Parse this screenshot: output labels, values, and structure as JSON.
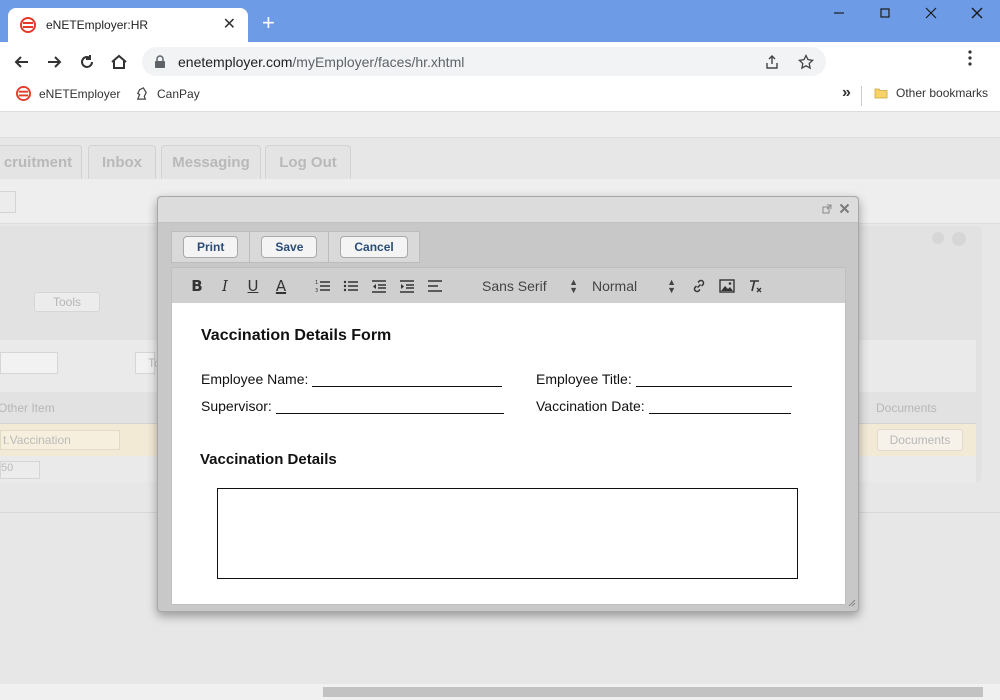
{
  "browser": {
    "tab_title": "eNETEmployer:HR",
    "tab_close": "✕",
    "new_tab": "+",
    "url_host": "enetemployer.com",
    "url_path": "/myEmployer/faces/hr.xhtml",
    "bookmarks": [
      "eNETEmployer",
      "CanPay"
    ],
    "bookmarks_overflow": "»",
    "other_bookmarks": "Other bookmarks",
    "accent": "#6d9be6"
  },
  "background": {
    "tabs": [
      "cruitment",
      "Inbox",
      "Messaging",
      "Log Out"
    ],
    "tools_label": "Tools",
    "grid_col_other": "Other Item",
    "grid_col_documents": "Documents",
    "row_item": "t.Vaccination",
    "row_documents_btn": "Documents",
    "pager_value": "50",
    "partial_to": "To"
  },
  "modal": {
    "actions": {
      "print": "Print",
      "save": "Save",
      "cancel": "Cancel"
    },
    "toolbar": {
      "font_family": "Sans Serif",
      "font_size": "Normal"
    },
    "document": {
      "title": "Vaccination Details Form",
      "employee_name_label": "Employee Name:",
      "employee_title_label": "Employee Title:",
      "supervisor_label": "Supervisor:",
      "vaccination_date_label": "Vaccination Date:",
      "section_title": "Vaccination Details"
    }
  }
}
